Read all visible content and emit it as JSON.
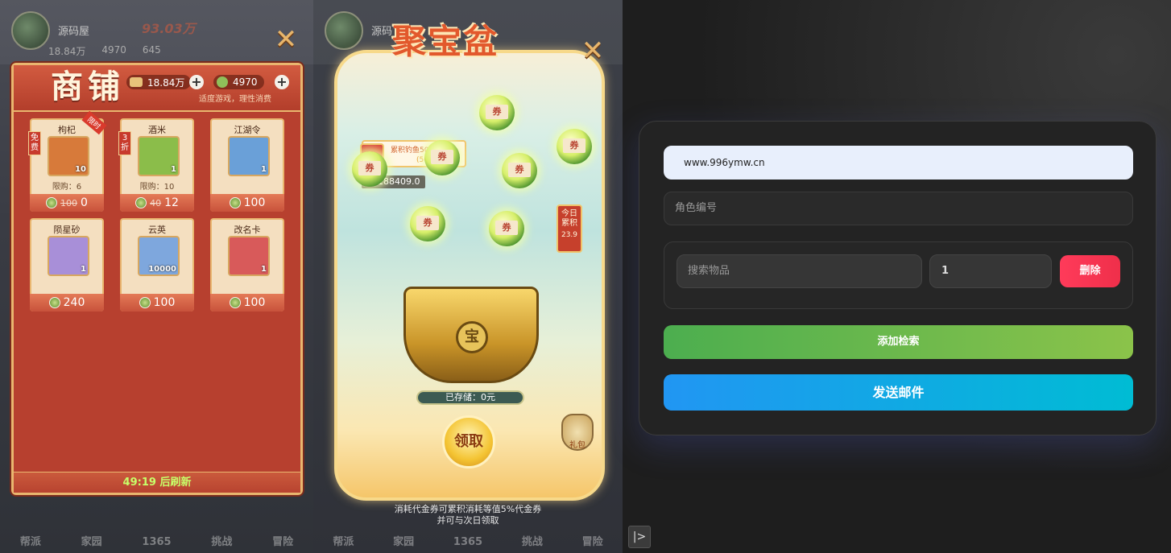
{
  "left": {
    "hud": {
      "name": "源码屋",
      "power": "93.03万",
      "stat1": "18.84万",
      "stat2": "4970",
      "stat3": "645"
    },
    "shop": {
      "title": "商铺",
      "currency1": "18.84万",
      "currency2": "4970",
      "tip": "适度游戏，理性消费",
      "items": [
        {
          "name": "枸杞",
          "qty": "10",
          "limit": "限购：6",
          "old_price": "100",
          "price": "0",
          "tag": "免费",
          "ribbon": "限时",
          "color": "#d77a3a"
        },
        {
          "name": "酒米",
          "qty": "1",
          "limit": "限购：10",
          "old_price": "40",
          "price": "12",
          "tag": "3折",
          "ribbon": "",
          "color": "#8bbd4a"
        },
        {
          "name": "江湖令",
          "qty": "1",
          "limit": "",
          "old_price": "",
          "price": "100",
          "tag": "",
          "ribbon": "",
          "color": "#6aa0d8"
        },
        {
          "name": "陨星砂",
          "qty": "1",
          "limit": "",
          "old_price": "",
          "price": "240",
          "tag": "",
          "ribbon": "",
          "color": "#a88fd8"
        },
        {
          "name": "云英",
          "qty": "10000",
          "limit": "",
          "old_price": "",
          "price": "100",
          "tag": "",
          "ribbon": "",
          "color": "#7ea7dd"
        },
        {
          "name": "改名卡",
          "qty": "1",
          "limit": "",
          "old_price": "",
          "price": "100",
          "tag": "",
          "ribbon": "",
          "color": "#d85a5a"
        }
      ],
      "refresh": "49:19 后刷新"
    },
    "nav": [
      "帮派",
      "家园",
      "1365",
      "挑战",
      "冒险"
    ]
  },
  "mid": {
    "hud": {
      "name": "源码"
    },
    "title": "聚宝盆",
    "accumulate_text": "累积钓鱼50次",
    "accumulate_count": "(50/50)",
    "balance": "188409.0",
    "orb_label": "券",
    "today_label": "今日累积",
    "today_value": "23.9",
    "basin_seal": "宝",
    "stored": "已存储：0元",
    "claim": "领取",
    "gift": "礼包",
    "note_line1": "消耗代金券可累积消耗等值5%代金券",
    "note_line2": "并可与次日领取",
    "nav": [
      "帮派",
      "家园",
      "1365",
      "挑战",
      "冒险"
    ]
  },
  "form": {
    "url_value": "www.996ymw.cn",
    "role_placeholder": "角色编号",
    "search_placeholder": "搜索物品",
    "qty_value": "1",
    "delete_label": "删除",
    "add_label": "添加检索",
    "send_label": "发送邮件",
    "collapse_icon": "|>"
  },
  "icons": {
    "close": "close-icon",
    "plus": "plus-icon",
    "coin": "coin-icon",
    "collapse": "sidebar-toggle-icon"
  }
}
